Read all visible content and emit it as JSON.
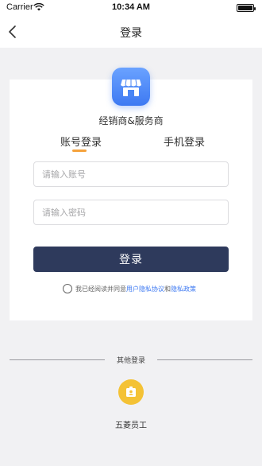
{
  "status_bar": {
    "carrier": "Carrier",
    "time": "10:34 AM"
  },
  "nav": {
    "title": "登录",
    "back_icon": "chevron-left-icon"
  },
  "brand": {
    "name": "经销商&服务商",
    "logo_icon": "store-icon",
    "logo_color": "#4a86f5"
  },
  "tabs": [
    {
      "label": "账号登录",
      "active": true
    },
    {
      "label": "手机登录",
      "active": false
    }
  ],
  "form": {
    "account_placeholder": "请输入账号",
    "password_placeholder": "请输入密码",
    "login_label": "登录",
    "login_color": "#2e3a5c"
  },
  "agreement": {
    "prefix": "我已经阅读并同意",
    "user_privacy": "用户隐私协议",
    "and": "和",
    "privacy_policy": "隐私政策",
    "checked": false,
    "link_color": "#3d79f2"
  },
  "other_login": {
    "title": "其他登录",
    "options": [
      {
        "label": "五菱员工",
        "icon": "employee-badge-icon",
        "color": "#f4c235"
      }
    ]
  },
  "accent_color": "#f5a23c"
}
